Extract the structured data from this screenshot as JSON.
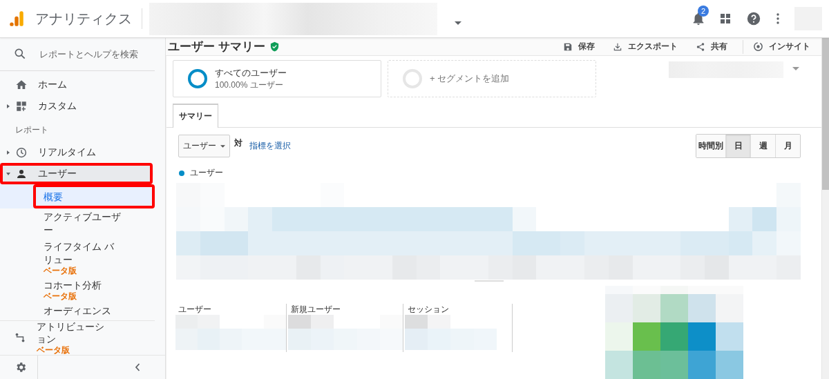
{
  "header": {
    "app_title": "アナリティクス",
    "notification_count": "2"
  },
  "sidebar": {
    "search_placeholder": "レポートとヘルプを検索",
    "top_items": [
      {
        "label": "ホーム",
        "kind": "link"
      },
      {
        "label": "カスタム",
        "kind": "group",
        "expanded": false
      }
    ],
    "section_label": "レポート",
    "report_items": [
      {
        "label": "リアルタイム",
        "kind": "group",
        "expanded": false,
        "selected": false
      },
      {
        "label": "ユーザー",
        "kind": "group",
        "expanded": true,
        "selected": true,
        "children": [
          {
            "label": "概要",
            "selected": true
          },
          {
            "label": "アクティブユーザー",
            "selected": false
          },
          {
            "label": "ライフタイム バリュー",
            "selected": false,
            "badge": "ベータ版"
          },
          {
            "label": "コホート分析",
            "selected": false,
            "badge": "ベータ版"
          },
          {
            "label": "オーディエンス",
            "selected": false
          }
        ]
      },
      {
        "label": "アトリビューション",
        "kind": "link",
        "selected": false,
        "badge": "ベータ版"
      }
    ]
  },
  "main": {
    "title": "ユーザー サマリー",
    "actions": [
      "保存",
      "エクスポート",
      "共有",
      "インサイト"
    ],
    "segments": [
      {
        "kind": "active",
        "label": "すべてのユーザー",
        "sublabel": "100.00% ユーザー"
      },
      {
        "kind": "add",
        "label": "+ セグメントを追加"
      }
    ],
    "tabs": [
      {
        "label": "サマリー",
        "selected": true
      }
    ],
    "metric_dropdown": "ユーザー",
    "versus": "対",
    "select_metric_link": "指標を選択",
    "granularity": [
      {
        "label": "時間別",
        "selected": false
      },
      {
        "label": "日",
        "selected": true
      },
      {
        "label": "週",
        "selected": false
      },
      {
        "label": "月",
        "selected": false
      }
    ],
    "legend": {
      "label": "ユーザー",
      "color": "#058dc7"
    },
    "metrics": [
      "ユーザー",
      "新規ユーザー",
      "セッション"
    ]
  }
}
